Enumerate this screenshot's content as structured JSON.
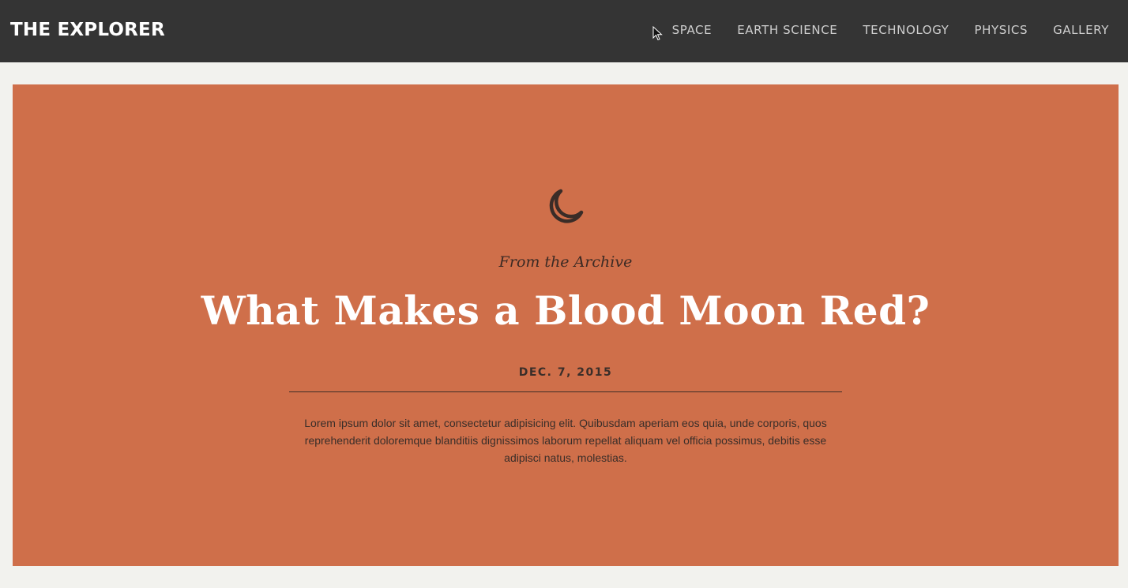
{
  "header": {
    "brand": "THE EXPLORER",
    "nav": [
      {
        "label": "SPACE"
      },
      {
        "label": "EARTH SCIENCE"
      },
      {
        "label": "TECHNOLOGY"
      },
      {
        "label": "PHYSICS"
      },
      {
        "label": "GALLERY"
      }
    ]
  },
  "hero": {
    "icon": "moon-icon",
    "kicker": "From the Archive",
    "title": "What Makes a Blood Moon Red?",
    "date": "DEC. 7, 2015",
    "excerpt": "Lorem ipsum dolor sit amet, consectetur adipisicing elit. Quibusdam aperiam eos quia, unde corporis, quos reprehenderit doloremque blanditiis dignissimos laborum repellat aliquam vel officia possimus, debitis esse adipisci natus, molestias."
  },
  "colors": {
    "topbar": "#343434",
    "hero_bg": "#cf6f4a",
    "page_bg": "#f2f2ee",
    "title": "#ffffff",
    "nav_text": "#cfcfcf"
  }
}
